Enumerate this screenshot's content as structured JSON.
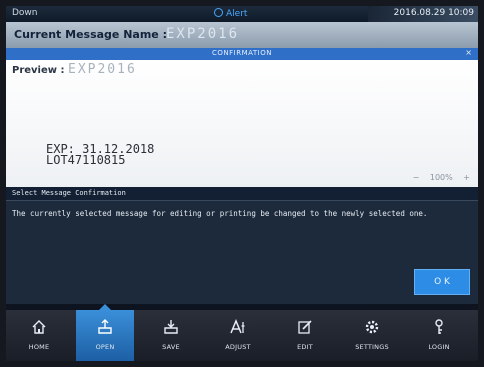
{
  "status_bar": {
    "state": "Down",
    "alarm": "Alert",
    "datetime": "2016.08.29 10:09"
  },
  "message_name": {
    "label": "Current Message Name :",
    "value": "EXP2016"
  },
  "confirmation": {
    "title": "CONFIRMATION",
    "close": "×"
  },
  "preview": {
    "label": "Preview :",
    "value": "EXP2016",
    "lines": [
      "EXP: 31.12.2018",
      "LOT47110815"
    ],
    "zoom_out": "−",
    "zoom_level": "100%",
    "zoom_in": "+"
  },
  "dialog": {
    "title": "Select Message Confirmation",
    "message": "The currently selected message for editing or printing be changed to the newly selected one.",
    "ok_label": "O K"
  },
  "nav": {
    "items": [
      {
        "label": "HOME",
        "icon": "home-icon"
      },
      {
        "label": "OPEN",
        "icon": "open-icon"
      },
      {
        "label": "SAVE",
        "icon": "save-icon"
      },
      {
        "label": "ADJUST",
        "icon": "adjust-icon"
      },
      {
        "label": "EDIT",
        "icon": "edit-icon"
      },
      {
        "label": "SETTINGS",
        "icon": "gear-icon"
      },
      {
        "label": "LOGIN",
        "icon": "login-icon"
      }
    ],
    "active": "OPEN"
  },
  "colors": {
    "accent": "#2f6fc7",
    "button": "#2d8ce6",
    "dialog_bg": "#1c2a3b",
    "nav_bg": "#1f2430"
  }
}
